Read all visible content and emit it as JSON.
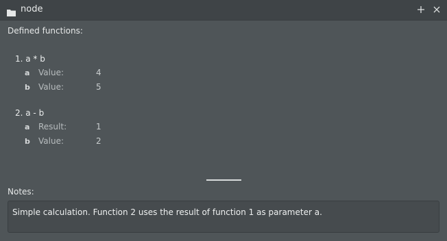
{
  "window": {
    "title": "node",
    "folder_icon": "folder-icon",
    "add_icon": "plus-icon",
    "close_icon": "close-icon"
  },
  "defined": {
    "label": "Defined functions:",
    "functions": [
      {
        "header": "1. a * b",
        "params": [
          {
            "name": "a",
            "kind": "Value:",
            "value": "4"
          },
          {
            "name": "b",
            "kind": "Value:",
            "value": "5"
          }
        ]
      },
      {
        "header": "2. a - b",
        "params": [
          {
            "name": "a",
            "kind": "Result:",
            "value": "1"
          },
          {
            "name": "b",
            "kind": "Value:",
            "value": "2"
          }
        ]
      }
    ]
  },
  "notes": {
    "label": "Notes:",
    "text": "Simple calculation. Function 2 uses the result of function 1 as parameter a."
  },
  "colors": {
    "background": "#4f5558",
    "titlebar": "#3f4447",
    "notes_box": "#464b4e"
  }
}
